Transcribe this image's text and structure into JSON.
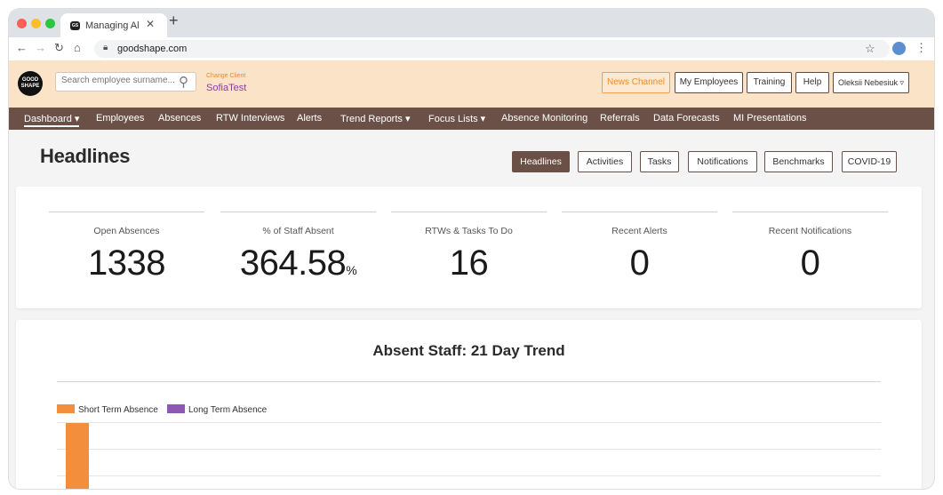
{
  "browser": {
    "tab_title": "Managing Al",
    "tab_favicon": "GS",
    "url": "goodshape.com"
  },
  "header": {
    "logo_line1": "GOOD",
    "logo_line2": "SHAPE",
    "search_placeholder": "Search employee surname...",
    "change_client_label": "Change Client",
    "client_name": "SofiaTest",
    "buttons": {
      "news_channel": "News Channel",
      "my_employees": "My Employees",
      "training": "Training",
      "help": "Help",
      "user": "Oleksii Nebesiuk ▿"
    }
  },
  "menu": [
    "Dashboard ▾",
    "Employees",
    "Absences",
    "RTW Interviews",
    "Alerts",
    "Trend Reports ▾",
    "Focus Lists ▾",
    "Absence Monitoring",
    "Referrals",
    "Data Forecasts",
    "MI Presentations"
  ],
  "page": {
    "title": "Headlines",
    "subtabs": [
      "Headlines",
      "Activities",
      "Tasks",
      "Notifications",
      "Benchmarks",
      "COVID-19"
    ]
  },
  "stats": [
    {
      "label": "Open Absences",
      "value": "1338",
      "unit": ""
    },
    {
      "label": "% of Staff Absent",
      "value": "364.58",
      "unit": "%"
    },
    {
      "label": "RTWs & Tasks To Do",
      "value": "16",
      "unit": ""
    },
    {
      "label": "Recent Alerts",
      "value": "0",
      "unit": ""
    },
    {
      "label": "Recent Notifications",
      "value": "0",
      "unit": ""
    }
  ],
  "chart": {
    "title": "Absent Staff: 21 Day Trend",
    "legend": [
      "Short Term Absence",
      "Long Term Absence"
    ]
  },
  "colors": {
    "brand_brown": "#6b5048",
    "header_bg": "#fbe3c8",
    "accent_orange": "#f08a24",
    "short_term": "#f28e3c",
    "long_term": "#8e59b3"
  },
  "chart_data": {
    "type": "bar",
    "title": "Absent Staff: 21 Day Trend",
    "series": [
      {
        "name": "Short Term Absence",
        "values": [
          null
        ]
      },
      {
        "name": "Long Term Absence",
        "values": [
          null
        ]
      }
    ]
  }
}
